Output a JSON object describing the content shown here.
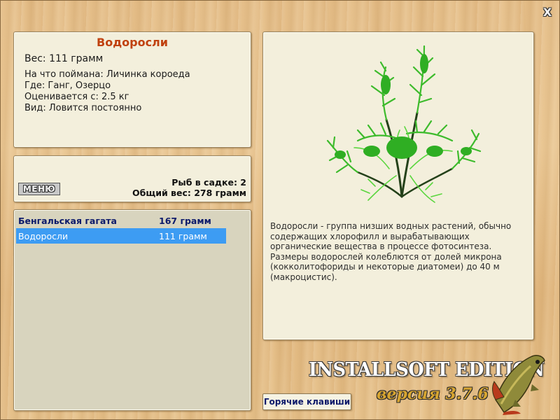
{
  "window": {
    "close_glyph": "X"
  },
  "info": {
    "title": "Водоросли",
    "weight": "Вес: 111 грамм",
    "bait": "На что поймана: Личинка короеда",
    "location": "Где: Ганг, Озерцо",
    "price": "Оценивается с: 2.5 кг",
    "frequency": "Вид: Ловится постоянно"
  },
  "status": {
    "menu_label": "МЕНЮ",
    "fish_in_net": "Рыб в садке: 2",
    "total_weight": "Общий вес: 278 грамм"
  },
  "catch_list": [
    {
      "name": "Бенгальская гагата",
      "weight": "167 грамм",
      "style": "bold"
    },
    {
      "name": "Водоросли",
      "weight": "111 грамм",
      "style": "selected"
    }
  ],
  "description": {
    "image_icon": "seaweed-image",
    "text": "Водоросли - группа низших водных растений, обычно содержащих хлорофилл и вырабатывающих органические вещества в процессе фотосинтеза. Размеры водорослей колеблются от долей микрона (кокколитофориды и некоторые диатомеи) до 40 м (макроцистис)."
  },
  "footer": {
    "hotkeys_label": "Горячие клавиши",
    "edition": "INSTALLSOFT EDITION",
    "version": "версия 3.7.6",
    "logo_icon": "pike-fish-logo"
  },
  "colors": {
    "title_accent": "#c0410f",
    "selection": "#3d9cf3",
    "link_blue": "#0c1a6b",
    "version_gold": "#d7a531"
  }
}
